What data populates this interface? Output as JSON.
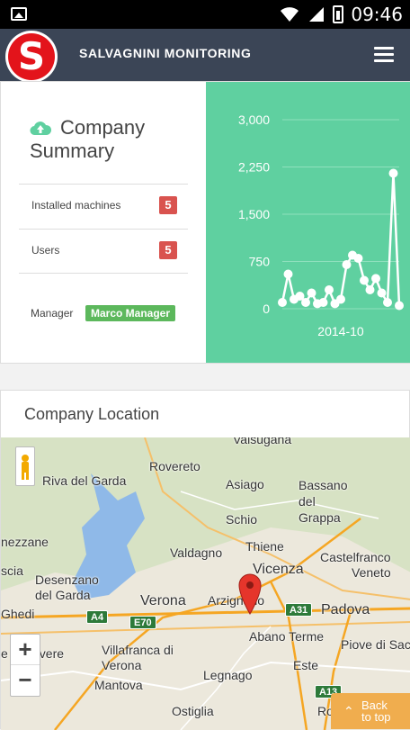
{
  "status_bar": {
    "time": "09:46"
  },
  "header": {
    "logo_letter": "S",
    "title": "SALVAGNINI MONITORING"
  },
  "summary": {
    "title": "Company Summary",
    "rows": [
      {
        "label": "Installed machines",
        "value": "5"
      },
      {
        "label": "Users",
        "value": "5"
      }
    ],
    "manager_label": "Manager",
    "manager_value": "Marco Manager"
  },
  "chart_data": {
    "type": "line",
    "ylim": [
      0,
      3000
    ],
    "yticks": [
      "3,000",
      "2,250",
      "1,500",
      "750",
      "0"
    ],
    "xlabel_tick": "2014-10",
    "x": [
      0,
      1,
      2,
      3,
      4,
      5,
      6,
      7,
      8,
      9,
      10,
      11,
      12,
      13,
      14,
      15,
      16,
      17,
      18,
      19,
      20
    ],
    "values": [
      100,
      550,
      150,
      200,
      100,
      250,
      80,
      100,
      300,
      80,
      150,
      700,
      850,
      800,
      450,
      300,
      480,
      250,
      100,
      2150,
      50
    ],
    "colors": {
      "background": "#5fd0a0",
      "line": "#ffffff",
      "grid": "#8fe0bd"
    }
  },
  "location": {
    "title": "Company Location",
    "places": [
      "Valsugana",
      "Rovereto",
      "Asiago",
      "Bassano del Grappa",
      "Riva del Garda",
      "Schio",
      "nezzane",
      "Thiene",
      "Castelfranco",
      "Valdagno",
      "Veneto",
      "scia",
      "Desenzano del Garda",
      "Vicenza",
      "Verona",
      "Arzignano",
      "Padova",
      "Ghedi",
      "Abano Terme",
      "Piove di Sac",
      "e di Stivere",
      "Villafranca di Verona",
      "Este",
      "Mantova",
      "Legnago",
      "Ostiglia",
      "Rov"
    ],
    "roads": [
      "A4",
      "E70",
      "A31",
      "A13"
    ]
  },
  "back_to_top": {
    "line1": "Back",
    "line2": "to top"
  }
}
